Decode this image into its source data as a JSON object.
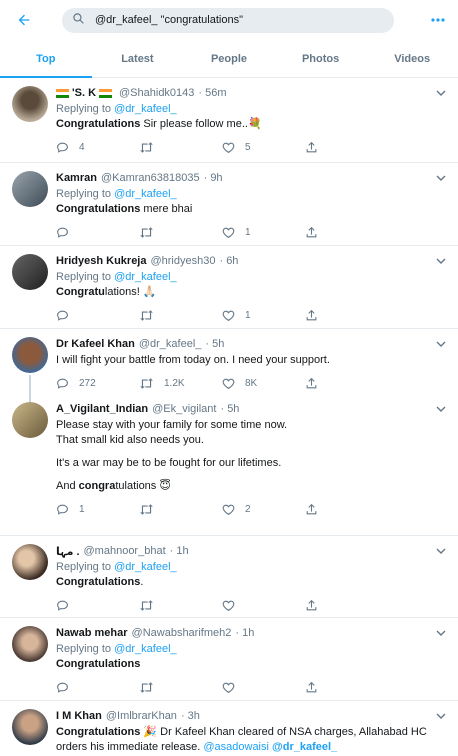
{
  "search": {
    "query": "@dr_kafeel_ \"congratulations\""
  },
  "tabs": [
    {
      "label": "Top"
    },
    {
      "label": "Latest"
    },
    {
      "label": "People"
    },
    {
      "label": "Photos"
    },
    {
      "label": "Videos"
    }
  ],
  "tweets": [
    {
      "name": "'S. K",
      "handle": "@Shahidk0143",
      "time": "· 56m",
      "replying": "Replying to",
      "replying_to": "@dr_kafeel_",
      "text_bold": "Congratulations",
      "text_rest": " Sir please follow me..",
      "replies": "4",
      "retweets": "",
      "likes": "5"
    },
    {
      "name": "Kamran",
      "handle": "@Kamran63818035",
      "time": "· 9h",
      "replying": "Replying to",
      "replying_to": "@dr_kafeel_",
      "text_bold": "Congratulations",
      "text_rest": " mere bhai",
      "replies": "",
      "retweets": "",
      "likes": "1"
    },
    {
      "name": "Hridyesh Kukreja",
      "handle": "@hridyesh30",
      "time": "· 6h",
      "replying": "Replying to",
      "replying_to": "@dr_kafeel_",
      "text_bold": "Congratu",
      "text_rest": "lations!",
      "replies": "",
      "retweets": "",
      "likes": "1"
    },
    {
      "name": "Dr Kafeel Khan",
      "handle": "@dr_kafeel_",
      "time": "· 5h",
      "text": "I will fight your battle from today on. I need your support.",
      "replies": "272",
      "retweets": "1.2K",
      "likes": "8K"
    },
    {
      "name": "A_Vigilant_Indian",
      "handle": "@Ek_vigilant",
      "time": "· 5h",
      "line1": "Please stay with your family for some time now.",
      "line2": "That small kid also needs you.",
      "line3": "It's a war may be to be fought for our lifetimes.",
      "line4_pre": "And ",
      "line4_bold": "congra",
      "line4_post": "tulations",
      "replies": "1",
      "retweets": "",
      "likes": "2"
    },
    {
      "name": "مہا .",
      "handle": "@mahnoor_bhat",
      "time": "· 1h",
      "replying": "Replying to",
      "replying_to": "@dr_kafeel_",
      "text_bold": "Congratulations",
      "text_rest": ".",
      "replies": "",
      "retweets": "",
      "likes": ""
    },
    {
      "name": "Nawab mehar",
      "handle": "@Nawabsharifmeh2",
      "time": "· 1h",
      "replying": "Replying to",
      "replying_to": "@dr_kafeel_",
      "text_bold": "Congratulations",
      "text_rest": "",
      "replies": "",
      "retweets": "",
      "likes": ""
    },
    {
      "name": "I M Khan",
      "handle": "@ImlbrarKhan",
      "time": "· 3h",
      "text_bold": "Congratulations",
      "text_rest": " Dr Kafeel Khan cleared of NSA charges, Allahabad HC",
      "text_line2": "orders his immediate release.",
      "mention1": "@asadowaisi",
      "mention2": "@dr_kafeel_"
    }
  ],
  "colors": {
    "accent": "#1da1f2",
    "muted": "#657786",
    "border": "#e6ecf0"
  },
  "icons": [
    "back-arrow-icon",
    "search-icon",
    "more-icon",
    "chevron-down-icon",
    "reply-icon",
    "retweet-icon",
    "like-icon",
    "share-icon"
  ]
}
